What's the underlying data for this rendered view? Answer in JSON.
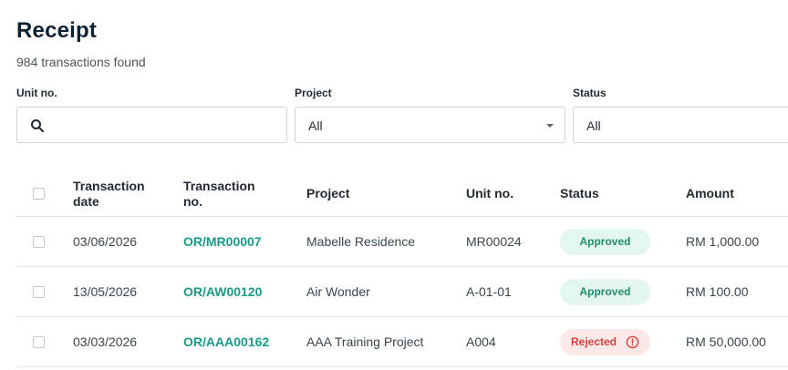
{
  "page": {
    "title": "Receipt",
    "subtitle": "984 transactions found"
  },
  "filters": {
    "unit": {
      "label": "Unit no.",
      "value": ""
    },
    "project": {
      "label": "Project",
      "value": "All"
    },
    "status": {
      "label": "Status",
      "value": "All"
    }
  },
  "table": {
    "headers": {
      "date_line1": "Transaction",
      "date_line2": "date",
      "txn_line1": "Transaction",
      "txn_line2": "no.",
      "project": "Project",
      "unit": "Unit no.",
      "status": "Status",
      "amount": "Amount"
    },
    "rows": [
      {
        "date": "03/06/2026",
        "txn": "OR/MR00007",
        "project": "Mabelle Residence",
        "unit": "MR00024",
        "status": "Approved",
        "amount": "RM 1,000.00"
      },
      {
        "date": "13/05/2026",
        "txn": "OR/AW00120",
        "project": "Air Wonder",
        "unit": "A-01-01",
        "status": "Approved",
        "amount": "RM 100.00"
      },
      {
        "date": "03/03/2026",
        "txn": "OR/AAA00162",
        "project": "AAA Training Project",
        "unit": "A004",
        "status": "Rejected",
        "amount": "RM 50,000.00"
      }
    ]
  },
  "colors": {
    "link": "#1a9a86",
    "approved_bg": "#e3f6ef",
    "approved_text": "#1f8f6b",
    "rejected_bg": "#fde8e8",
    "rejected_text": "#d8413f"
  },
  "icons": {
    "search": "search-icon",
    "caret": "chevron-down-icon",
    "rejected": "alert-circle-icon"
  }
}
